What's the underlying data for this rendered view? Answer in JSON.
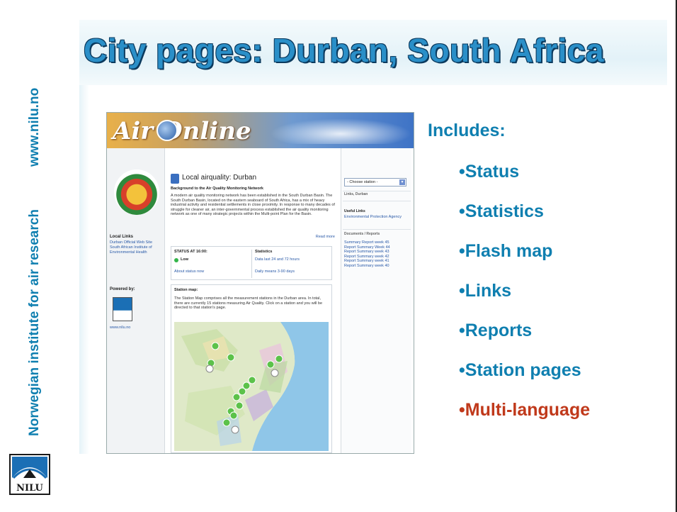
{
  "side": {
    "url": "www.nilu.no",
    "org": "Norwegian institute for air research",
    "logo_text": "NILU"
  },
  "title": "City pages: Durban, South Africa",
  "screenshot": {
    "brand": "Air Online",
    "left": {
      "links_title": "Local Links",
      "links": [
        "Durban Official Web Site",
        "South African Institute of",
        "Environmental Health"
      ],
      "powered_by": "Powered by:",
      "nilu_url": "www.nilu.no"
    },
    "main": {
      "heading": "Local airquality: Durban",
      "subheading": "Background to the Air Quality Monitoring Network",
      "body": "A modern air quality monitoring network has been established in the South Durban Basin. The South Durban Basin, located on the eastern seaboard of South Africa, has a mix of heavy industrial activity and residential settlements in close proximity. In response to many decades of struggle for cleaner air, an inter-governmental process established the air quality monitoring network as one of many strategic projects within the Multi-point Plan for the Basin.",
      "read_more": "Read more",
      "status_heading": "STATUS AT 16:00:",
      "status_value": "Low",
      "about_status": "About status now",
      "statistics_heading": "Statistics",
      "stat_link_1": "Data last 24 and 72 hours",
      "stat_link_2": "Daily means 3-90 days",
      "map_heading": "Station map:",
      "map_text": "The Station Map comprises all the measurement stations in the Durban area. In total, there are currently 15 stations measuring Air Quality. Click on a station and you will be directed to that station's page."
    },
    "right": {
      "select": "- Choose station -",
      "links_heading": "Links, Durban",
      "useful_heading": "Useful Links",
      "useful_link": "Environmental Protection Agency",
      "docs_heading": "Documents / Reports",
      "reports": [
        "Summary Report week 45",
        "Report Summary Week 44",
        "Report Summary week 43",
        "Report Summary week 42",
        "Report Summary week 41",
        "Report Summary week 40"
      ]
    }
  },
  "includes_label": "Includes:",
  "bullets": [
    {
      "text": "•Status",
      "color": "#0f7fb0"
    },
    {
      "text": "•Statistics",
      "color": "#0f7fb0"
    },
    {
      "text": "•Flash map",
      "color": "#0f7fb0"
    },
    {
      "text": "•Links",
      "color": "#0f7fb0"
    },
    {
      "text": "•Reports",
      "color": "#0f7fb0"
    },
    {
      "text": "•Station pages",
      "color": "#0f7fb0"
    },
    {
      "text": "•Multi-language",
      "color": "#c0391b"
    }
  ]
}
